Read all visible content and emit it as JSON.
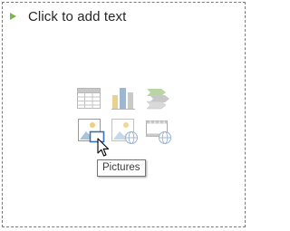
{
  "placeholder": {
    "prompt": "Click to add text",
    "bullet_color": "#7ab648"
  },
  "content_icons": [
    {
      "name": "table-icon"
    },
    {
      "name": "chart-icon"
    },
    {
      "name": "smartart-icon"
    },
    {
      "name": "pictures-icon",
      "hovered": true
    },
    {
      "name": "online-pictures-icon"
    },
    {
      "name": "video-icon"
    }
  ],
  "tooltip": {
    "text": "Pictures"
  },
  "cursor": {
    "icon": "arrow-cursor"
  }
}
